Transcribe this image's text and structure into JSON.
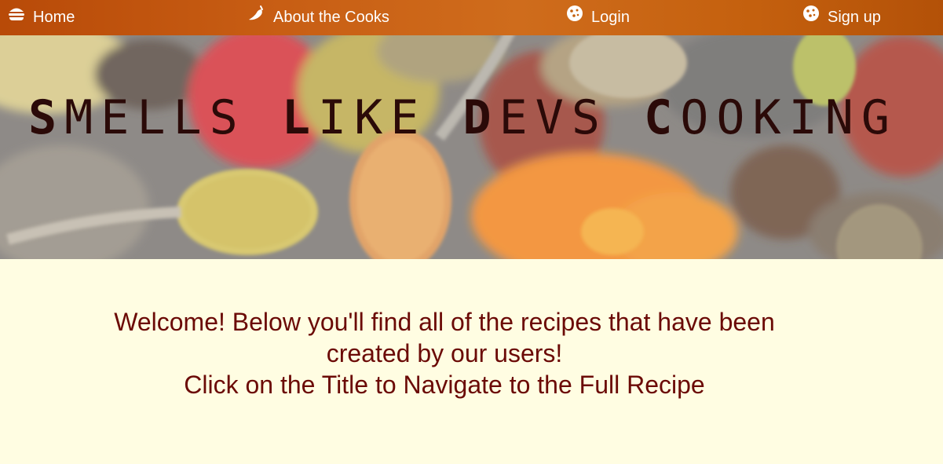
{
  "nav": {
    "items": [
      {
        "label": "Home",
        "icon": "burger-icon"
      },
      {
        "label": "About the Cooks",
        "icon": "chili-pepper-icon"
      },
      {
        "label": "Login",
        "icon": "cookie-icon"
      },
      {
        "label": "Sign up",
        "icon": "cookie-icon"
      }
    ]
  },
  "hero": {
    "title_words": [
      {
        "first": "S",
        "rest": "MELLS"
      },
      {
        "first": "L",
        "rest": "IKE"
      },
      {
        "first": "D",
        "rest": "EVS"
      },
      {
        "first": "C",
        "rest": "OOKING"
      }
    ]
  },
  "welcome": {
    "line1": "Welcome! Below you'll find all of the recipes that have been created by our users!",
    "line2": "Click on the Title to Navigate to the Full Recipe"
  },
  "colors": {
    "nav_bg": "#c4600e",
    "page_bg": "#fffde2",
    "welcome_text": "#6b0a06",
    "title_text": "#2b0a08"
  }
}
